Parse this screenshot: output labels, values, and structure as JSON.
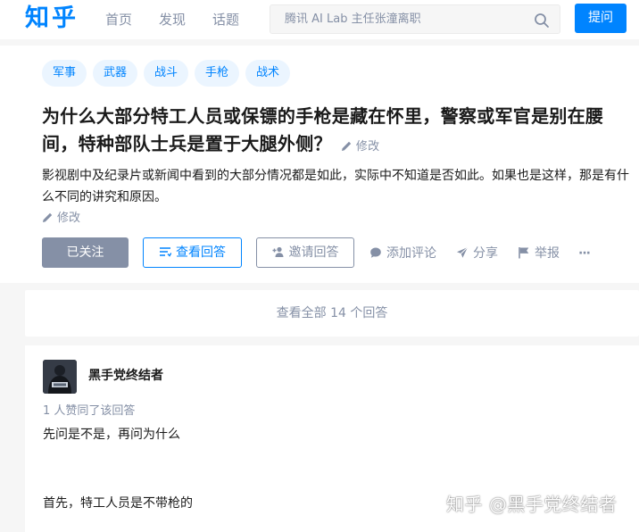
{
  "header": {
    "logo": "知乎",
    "nav": [
      "首页",
      "发现",
      "话题"
    ],
    "search_placeholder": "腾讯 AI Lab 主任张潼离职",
    "ask_label": "提问"
  },
  "question": {
    "tags": [
      "军事",
      "武器",
      "战斗",
      "手枪",
      "战术"
    ],
    "title": "为什么大部分特工人员或保镖的手枪是藏在怀里，警察或军官是别在腰间，特种部队士兵是置于大腿外侧？",
    "title_edit": "修改",
    "description": "影视剧中及纪录片或新闻中看到的大部分情况都是如此，实际中不知道是否如此。如果也是这样，那是有什么不同的讲究和原因。",
    "desc_edit": "修改",
    "buttons": {
      "follow": "已关注",
      "view_answers": "查看回答",
      "invite": "邀请回答",
      "comment": "添加评论",
      "share": "分享",
      "report": "举报",
      "more": "···"
    }
  },
  "view_all": "查看全部 14 个回答",
  "answer": {
    "author": "黑手党终结者",
    "votes": "1 人赞同了该回答",
    "paragraphs": [
      "先问是不是，再问为什么",
      "首先，特工人员是不带枪的"
    ],
    "watermark": "知乎 @黑手党终结者"
  },
  "colors": {
    "brand": "#0084ff",
    "muted": "#8590a6",
    "background": "#f6f6f6"
  },
  "icons": [
    "search-icon",
    "pencil-icon",
    "list-icon",
    "add-user-icon",
    "comment-icon",
    "share-icon",
    "flag-icon",
    "more-icon"
  ]
}
